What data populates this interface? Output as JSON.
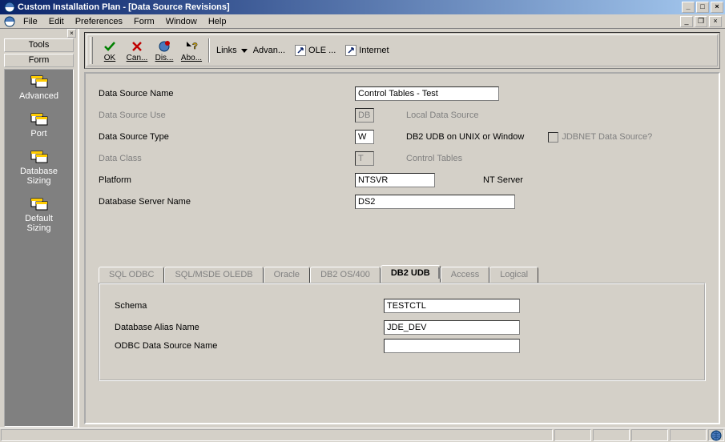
{
  "title": "Custom Installation Plan - [Data Source Revisions]",
  "menus": {
    "file": "File",
    "edit": "Edit",
    "prefs": "Preferences",
    "form": "Form",
    "window": "Window",
    "help": "Help"
  },
  "sidebar": {
    "tools": "Tools",
    "form": "Form",
    "items": [
      {
        "label": "Advanced"
      },
      {
        "label": "Port"
      },
      {
        "label": "Database\nSizing"
      },
      {
        "label": "Default\nSizing"
      }
    ]
  },
  "toolbar": {
    "ok": "OK",
    "cancel": "Can...",
    "dis": "Dis...",
    "about": "Abo...",
    "links": "Links",
    "advanced": "Advan...",
    "ole": "OLE ...",
    "internet": "Internet"
  },
  "form": {
    "labels": {
      "dsname": "Data Source Name",
      "dsuse": "Data Source Use",
      "dstype": "Data Source Type",
      "dataclass": "Data Class",
      "platform": "Platform",
      "dbserver": "Database Server Name"
    },
    "values": {
      "dsname": "Control Tables - Test",
      "dsuse": "DB",
      "dstype": "W",
      "dataclass": "T",
      "platform": "NTSVR",
      "dbserver": "DS2"
    },
    "descr": {
      "dsuse": "Local Data Source",
      "dstype": "DB2 UDB on UNIX or Window",
      "dataclass": "Control Tables",
      "platform": "NT Server"
    },
    "checkbox": {
      "jdbnet": "JDBNET Data Source?"
    }
  },
  "tabs": {
    "items": [
      {
        "label": "SQL ODBC"
      },
      {
        "label": "SQL/MSDE OLEDB"
      },
      {
        "label": "Oracle"
      },
      {
        "label": "DB2 OS/400"
      },
      {
        "label": "DB2 UDB"
      },
      {
        "label": "Access"
      },
      {
        "label": "Logical"
      }
    ],
    "active_index": 4,
    "panel": {
      "labels": {
        "schema": "Schema",
        "alias": "Database Alias Name",
        "odbc": "ODBC Data Source Name"
      },
      "values": {
        "schema": "TESTCTL",
        "alias": "JDE_DEV",
        "odbc": ""
      }
    }
  },
  "icons": {
    "app": "sphere-icon",
    "ok": "check-icon",
    "cancel": "x-icon",
    "dis": "globe-red-icon",
    "about": "help-arrow-icon",
    "dropdown": "triangle-down-icon",
    "ole": "arrow-box-icon",
    "internet": "arrow-box-icon",
    "side": "cascade-windows-icon",
    "globe": "globe-icon"
  },
  "colors": {
    "titlebar_start": "#0a246a",
    "titlebar_end": "#a6caf0",
    "chrome": "#d4d0c8",
    "sidebar_bg": "#808080"
  }
}
